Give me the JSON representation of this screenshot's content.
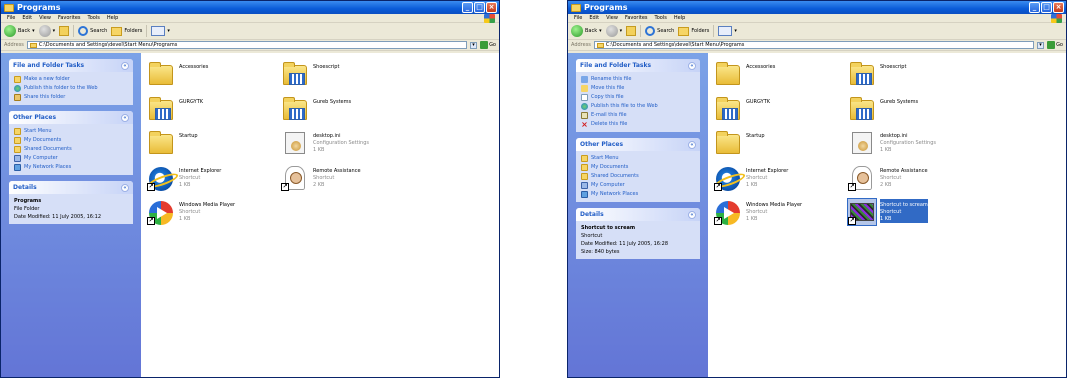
{
  "menu": [
    "File",
    "Edit",
    "View",
    "Favorites",
    "Tools",
    "Help"
  ],
  "toolbar": {
    "back": "Back",
    "search": "Search",
    "folders": "Folders"
  },
  "address": {
    "label": "Address",
    "go": "Go"
  },
  "windows": [
    {
      "title": "Programs",
      "path": "C:\\Documents and Settings\\devel\\Start Menu\\Programs",
      "tasks_title": "File and Folder Tasks",
      "tasks": [
        {
          "icon": "folder-new",
          "label": "Make a new folder"
        },
        {
          "icon": "globe",
          "label": "Publish this folder to the Web"
        },
        {
          "icon": "share",
          "label": "Share this folder"
        }
      ],
      "places_title": "Other Places",
      "places": [
        {
          "icon": "folder",
          "label": "Start Menu"
        },
        {
          "icon": "folder",
          "label": "My Documents"
        },
        {
          "icon": "folder",
          "label": "Shared Documents"
        },
        {
          "icon": "computer",
          "label": "My Computer"
        },
        {
          "icon": "network",
          "label": "My Network Places"
        }
      ],
      "details_title": "Details",
      "details": {
        "name": "Programs",
        "type": "File Folder",
        "modified": "Date Modified: 11 July 2005, 16:12",
        "size": ""
      },
      "files": [
        {
          "icon": "folder",
          "name": "Accessories",
          "sub1": "",
          "sub2": ""
        },
        {
          "icon": "folder-grid",
          "name": "Shoescript",
          "sub1": "",
          "sub2": ""
        },
        {
          "icon": "folder-grid",
          "name": "GURGYTK",
          "sub1": "",
          "sub2": ""
        },
        {
          "icon": "folder-grid",
          "name": "Gureb Systems",
          "sub1": "",
          "sub2": ""
        },
        {
          "icon": "folder",
          "name": "Startup",
          "sub1": "",
          "sub2": ""
        },
        {
          "icon": "ini",
          "name": "desktop.ini",
          "sub1": "Configuration Settings",
          "sub2": "1 KB"
        },
        {
          "icon": "ie",
          "name": "Internet Explorer",
          "sub1": "Shortcut",
          "sub2": "1 KB"
        },
        {
          "icon": "remote-assistance",
          "name": "Remote Assistance",
          "sub1": "Shortcut",
          "sub2": "2 KB"
        },
        {
          "icon": "wmp",
          "name": "Windows Media Player",
          "sub1": "Shortcut",
          "sub2": "1 KB"
        }
      ]
    },
    {
      "title": "Programs",
      "path": "C:\\Documents and Settings\\devel\\Start Menu\\Programs",
      "tasks_title": "File and Folder Tasks",
      "tasks": [
        {
          "icon": "rename",
          "label": "Rename this file"
        },
        {
          "icon": "move",
          "label": "Move this file"
        },
        {
          "icon": "copy",
          "label": "Copy this file"
        },
        {
          "icon": "globe",
          "label": "Publish this file to the Web"
        },
        {
          "icon": "mail",
          "label": "E-mail this file"
        },
        {
          "icon": "delete",
          "label": "Delete this file"
        }
      ],
      "places_title": "Other Places",
      "places": [
        {
          "icon": "folder",
          "label": "Start Menu"
        },
        {
          "icon": "folder",
          "label": "My Documents"
        },
        {
          "icon": "folder",
          "label": "Shared Documents"
        },
        {
          "icon": "computer",
          "label": "My Computer"
        },
        {
          "icon": "network",
          "label": "My Network Places"
        }
      ],
      "details_title": "Details",
      "details": {
        "name": "Shortcut to scream",
        "type": "Shortcut",
        "modified": "Date Modified: 11 July 2005, 16:28",
        "size": "Size: 840 bytes"
      },
      "files": [
        {
          "icon": "folder",
          "name": "Accessories",
          "sub1": "",
          "sub2": ""
        },
        {
          "icon": "folder-grid",
          "name": "Shoescript",
          "sub1": "",
          "sub2": ""
        },
        {
          "icon": "folder-grid",
          "name": "GURGYTK",
          "sub1": "",
          "sub2": ""
        },
        {
          "icon": "folder-grid",
          "name": "Gureb Systems",
          "sub1": "",
          "sub2": ""
        },
        {
          "icon": "folder",
          "name": "Startup",
          "sub1": "",
          "sub2": ""
        },
        {
          "icon": "ini",
          "name": "desktop.ini",
          "sub1": "Configuration Settings",
          "sub2": "1 KB"
        },
        {
          "icon": "ie",
          "name": "Internet Explorer",
          "sub1": "Shortcut",
          "sub2": "1 KB"
        },
        {
          "icon": "remote-assistance",
          "name": "Remote Assistance",
          "sub1": "Shortcut",
          "sub2": "2 KB"
        },
        {
          "icon": "wmp",
          "name": "Windows Media Player",
          "sub1": "Shortcut",
          "sub2": "1 KB"
        },
        {
          "icon": "scream",
          "name": "Shortcut to scream",
          "sub1": "Shortcut",
          "sub2": "1 KB",
          "selected": true
        }
      ]
    }
  ]
}
